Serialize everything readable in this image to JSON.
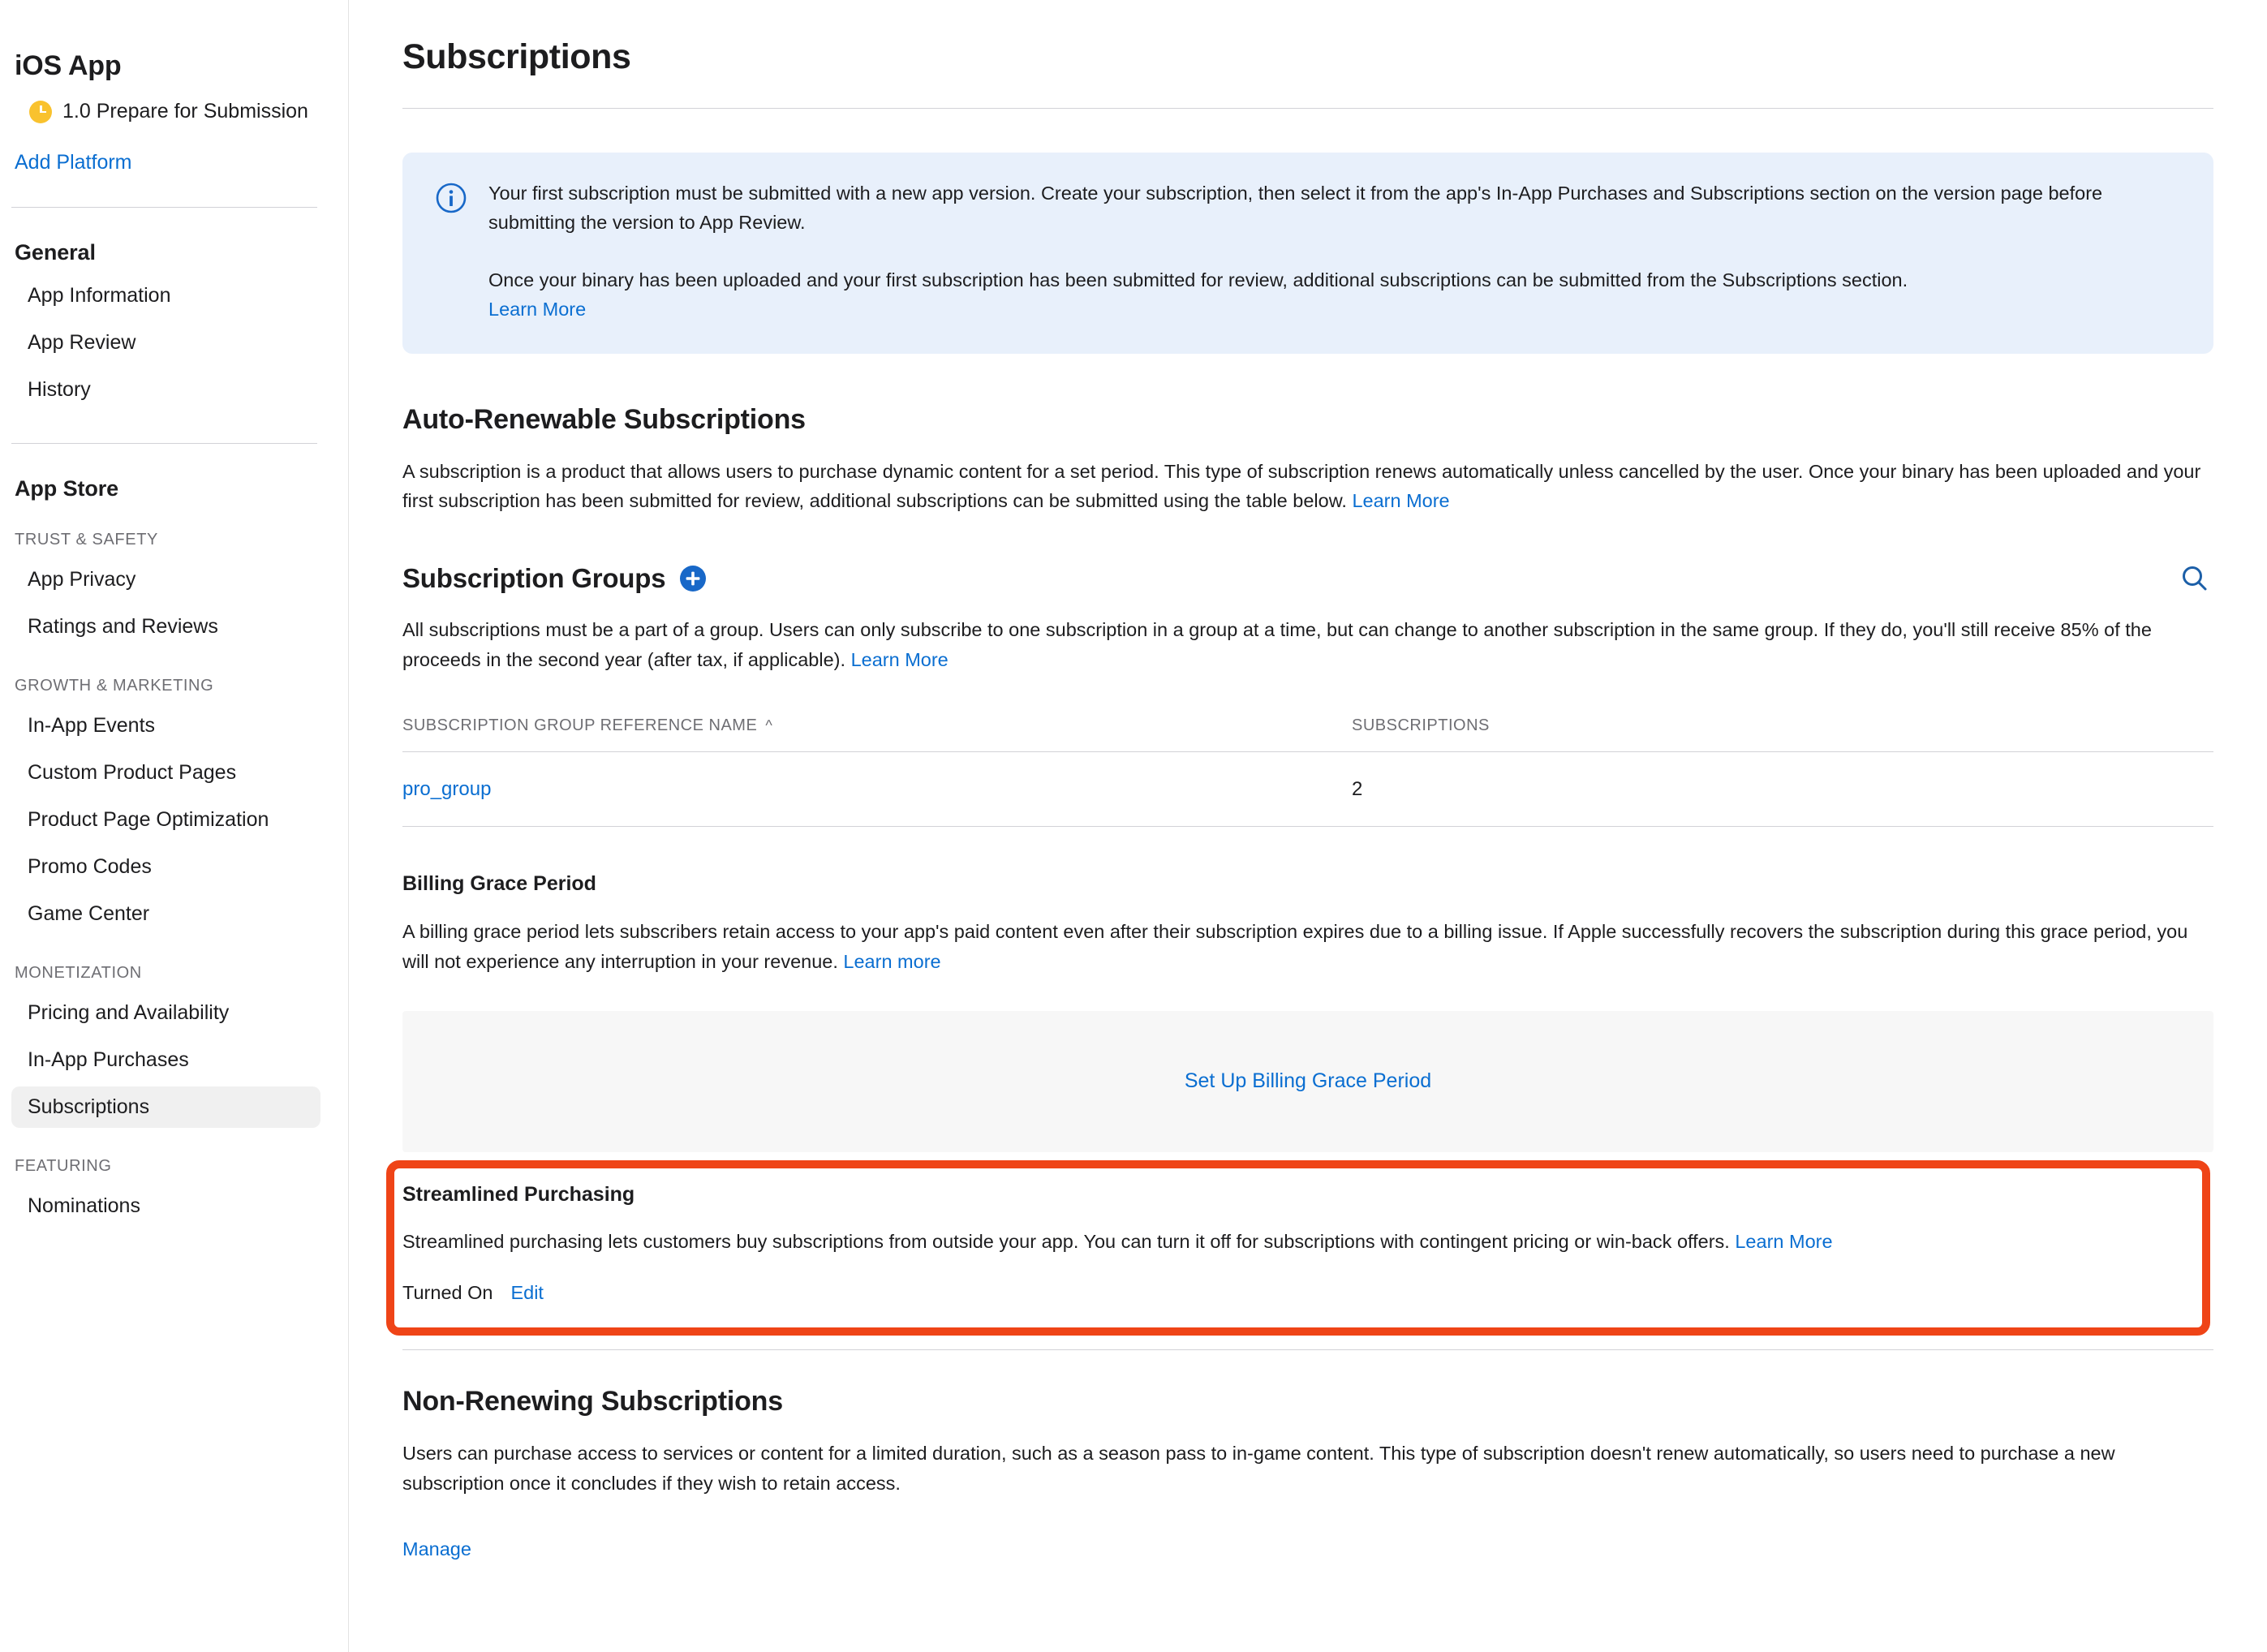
{
  "sidebar": {
    "app_title": "iOS App",
    "version_status": "1.0 Prepare for Submission",
    "add_platform": "Add Platform",
    "general_title": "General",
    "general_items": [
      {
        "label": "App Information"
      },
      {
        "label": "App Review"
      },
      {
        "label": "History"
      }
    ],
    "app_store_title": "App Store",
    "sections": [
      {
        "label": "TRUST & SAFETY",
        "items": [
          {
            "label": "App Privacy"
          },
          {
            "label": "Ratings and Reviews"
          }
        ]
      },
      {
        "label": "GROWTH & MARKETING",
        "items": [
          {
            "label": "In-App Events"
          },
          {
            "label": "Custom Product Pages"
          },
          {
            "label": "Product Page Optimization"
          },
          {
            "label": "Promo Codes"
          },
          {
            "label": "Game Center"
          }
        ]
      },
      {
        "label": "MONETIZATION",
        "items": [
          {
            "label": "Pricing and Availability"
          },
          {
            "label": "In-App Purchases"
          },
          {
            "label": "Subscriptions",
            "selected": true
          }
        ]
      },
      {
        "label": "FEATURING",
        "items": [
          {
            "label": "Nominations"
          }
        ]
      }
    ]
  },
  "main": {
    "page_title": "Subscriptions",
    "info_banner": {
      "paragraph1": "Your first subscription must be submitted with a new app version. Create your subscription, then select it from the app's In-App Purchases and Subscriptions section on the version page before submitting the version to App Review.",
      "paragraph2": "Once your binary has been uploaded and your first subscription has been submitted for review, additional subscriptions can be submitted from the Subscriptions section.",
      "learn_more": "Learn More"
    },
    "auto_renewable": {
      "title": "Auto-Renewable Subscriptions",
      "description": "A subscription is a product that allows users to purchase dynamic content for a set period. This type of subscription renews automatically unless cancelled by the user. Once your binary has been uploaded and your first subscription has been submitted for review, additional subscriptions can be submitted using the table below.",
      "learn_more": "Learn More"
    },
    "subscription_groups": {
      "title": "Subscription Groups",
      "description": "All subscriptions must be a part of a group. Users can only subscribe to one subscription in a group at a time, but can change to another subscription in the same group. If they do, you'll still receive 85% of the proceeds in the second year (after tax, if applicable).",
      "learn_more": "Learn More",
      "columns": [
        "SUBSCRIPTION GROUP REFERENCE NAME",
        "SUBSCRIPTIONS"
      ],
      "sort_indicator": "^",
      "rows": [
        {
          "name": "pro_group",
          "subscriptions": "2"
        }
      ]
    },
    "billing_grace_period": {
      "title": "Billing Grace Period",
      "description": "A billing grace period lets subscribers retain access to your app's paid content even after their subscription expires due to a billing issue. If Apple successfully recovers the subscription during this grace period, you will not experience any interruption in your revenue.",
      "learn_more": "Learn more",
      "setup_button": "Set Up Billing Grace Period"
    },
    "streamlined_purchasing": {
      "title": "Streamlined Purchasing",
      "description": "Streamlined purchasing lets customers buy subscriptions from outside your app. You can turn it off for subscriptions with contingent pricing or win-back offers.",
      "learn_more": "Learn More",
      "status": "Turned On",
      "edit": "Edit",
      "highlight_color": "#ef4417"
    },
    "non_renewing": {
      "title": "Non-Renewing Subscriptions",
      "description": "Users can purchase access to services or content for a limited duration, such as a season pass to in-game content. This type of subscription doesn't renew automatically, so users need to purchase a new subscription once it concludes if they wish to retain access.",
      "manage": "Manage"
    }
  },
  "colors": {
    "link": "#0a6ed1",
    "info_bg": "#e8f0fb",
    "status_yellow": "#f9c22e"
  }
}
